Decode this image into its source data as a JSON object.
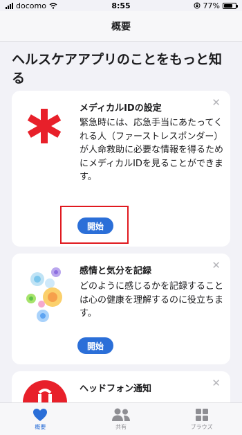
{
  "status_bar": {
    "carrier": "docomo",
    "time": "8:55",
    "battery_percent": "77%",
    "battery_level": 0.77
  },
  "nav": {
    "title": "概要"
  },
  "section": {
    "title": "ヘルスケアアプリのことをもっと知る"
  },
  "cards": [
    {
      "title": "メディカルIDの設定",
      "body": "緊急時には、応急手当にあたってくれる人（ファーストレスポンダー）が人命救助に必要な情報を得るためにメディカルIDを見ることができます。",
      "button": "開始",
      "close": "✕",
      "icon": "asterisk-icon"
    },
    {
      "title": "感情と気分を記録",
      "body": "どのように感じるかを記録することは心の健康を理解するのに役立ちます。",
      "button": "開始",
      "close": "✕",
      "icon": "flowers-icon"
    },
    {
      "title": "ヘッドフォン通知",
      "close": "✕",
      "icon": "headphone-icon"
    }
  ],
  "tabs": [
    {
      "label": "概要",
      "icon": "heart-icon",
      "active": true
    },
    {
      "label": "共有",
      "icon": "people-icon",
      "active": false
    },
    {
      "label": "ブラウズ",
      "icon": "grid-icon",
      "active": false
    }
  ],
  "colors": {
    "accent": "#2b6fd8",
    "medical_red": "#e8202a",
    "highlight": "#e0191f",
    "background": "#f2f2f7"
  }
}
